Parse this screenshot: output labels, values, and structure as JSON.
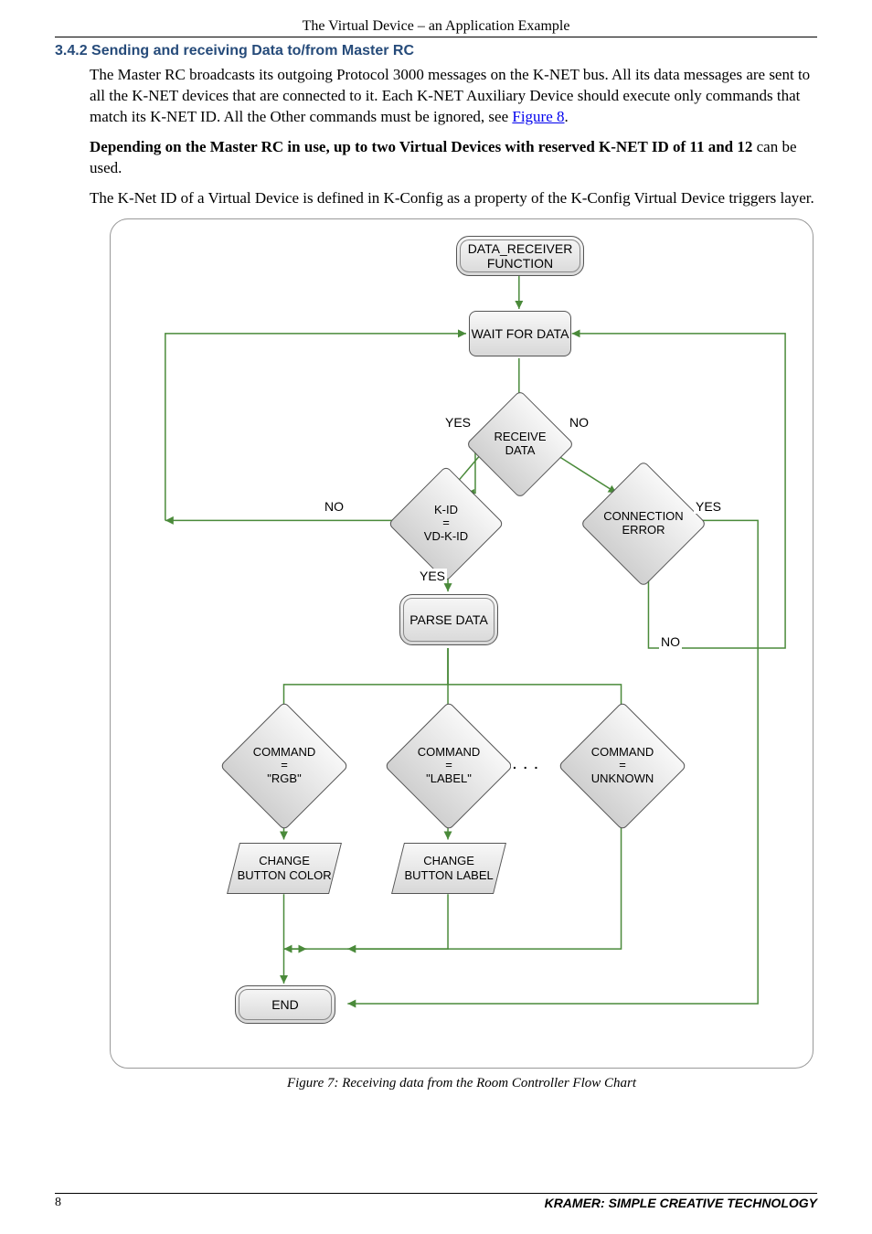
{
  "header": {
    "running_title": "The Virtual Device – an Application Example"
  },
  "section": {
    "number": "3.4.2",
    "title": "Sending and receiving Data to/from Master RC"
  },
  "paragraphs": {
    "p1_a": "The Master RC broadcasts its outgoing Protocol 3000 messages on the K-NET bus. All its data messages are sent to all the K-NET devices that are connected to it. Each K-NET Auxiliary Device should execute only commands that match its K-NET ID. All the Other commands must be ignored, see ",
    "p1_link": "Figure 8",
    "p1_b": ".",
    "p2_bold": "Depending on the Master RC in use, up to two Virtual Devices with reserved K-NET ID of 11 and 12",
    "p2_rest": " can be used.",
    "p3": "The K-Net ID of a Virtual Device is defined in K-Config as a property of the K-Config Virtual Device triggers layer."
  },
  "flow": {
    "data_receiver": "DATA_RECEIVER FUNCTION",
    "wait_for_data": "WAIT FOR DATA",
    "receive_data": "RECEIVE DATA",
    "kid": "K-ID\n=\nVD-K-ID",
    "conn_err": "CONNECTION ERROR",
    "parse_data": "PARSE DATA",
    "cmd_rgb": "COMMAND\n=\n\"RGB\"",
    "cmd_label": "COMMAND\n=\n\"LABEL\"",
    "cmd_unknown": "COMMAND\n=\nUNKNOWN",
    "ellipsis": ". . .",
    "change_color": "CHANGE BUTTON COLOR",
    "change_label": "CHANGE BUTTON LABEL",
    "end": "END",
    "yes": "YES",
    "no": "NO"
  },
  "figure": {
    "caption": "Figure 7: Receiving data from the Room Controller Flow Chart"
  },
  "footer": {
    "page": "8",
    "brand": "KRAMER:  SIMPLE CREATIVE TECHNOLOGY"
  }
}
